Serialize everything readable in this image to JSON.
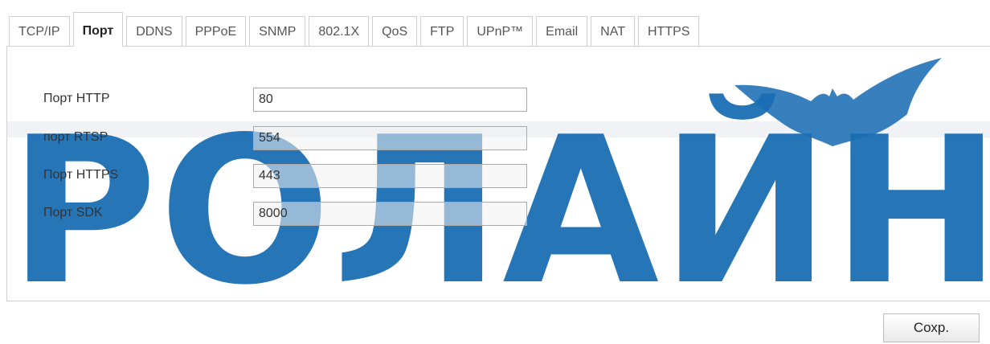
{
  "tabs": [
    {
      "label": "TCP/IP",
      "active": false
    },
    {
      "label": "Порт",
      "active": true
    },
    {
      "label": "DDNS",
      "active": false
    },
    {
      "label": "PPPoE",
      "active": false
    },
    {
      "label": "SNMP",
      "active": false
    },
    {
      "label": "802.1X",
      "active": false
    },
    {
      "label": "QoS",
      "active": false
    },
    {
      "label": "FTP",
      "active": false
    },
    {
      "label": "UPnP™",
      "active": false
    },
    {
      "label": "Email",
      "active": false
    },
    {
      "label": "NAT",
      "active": false
    },
    {
      "label": "HTTPS",
      "active": false
    }
  ],
  "ports": {
    "http": {
      "label": "Порт HTTP",
      "value": "80"
    },
    "rtsp": {
      "label": "порт RTSP",
      "value": "554"
    },
    "https": {
      "label": "Порт HTTPS",
      "value": "443"
    },
    "sdk": {
      "label": "Порт SDK",
      "value": "8000"
    }
  },
  "watermark": {
    "text": "РОЛАЙН",
    "color": "#1b6eb4"
  },
  "save_label": "Сохр."
}
